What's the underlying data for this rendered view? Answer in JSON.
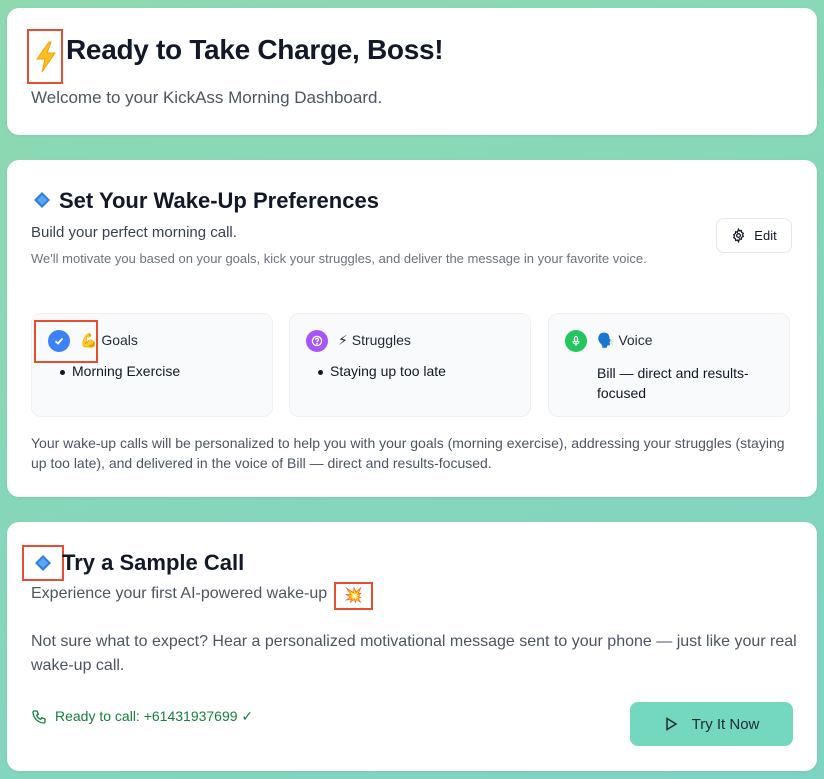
{
  "hero": {
    "title": "Ready to Take Charge, Boss!",
    "subtitle": "Welcome to your KickAss Morning Dashboard.",
    "icon": "lightning-bolt-icon"
  },
  "preferences": {
    "title": "Set Your Wake-Up Preferences",
    "subtitle": "Build your perfect morning call.",
    "description": "We'll motivate you based on your goals, kick your struggles, and deliver the message in your favorite voice.",
    "edit_label": "Edit",
    "goals": {
      "emoji": "💪",
      "label": "Goals",
      "items": [
        "Morning Exercise"
      ],
      "icon_color": "#3b82f6"
    },
    "struggles": {
      "emoji": "⚡",
      "label": "Struggles",
      "items": [
        "Staying up too late"
      ],
      "icon_color": "#a855f7"
    },
    "voice": {
      "emoji": "🗣️",
      "label": "Voice",
      "value": "Bill — direct and results-focused",
      "icon_color": "#22c55e"
    },
    "summary": "Your wake-up calls will be personalized to help you with your goals (morning exercise), addressing your struggles (staying up too late), and delivered in the voice of Bill — direct and results-focused."
  },
  "sample_call": {
    "title": "Try a Sample Call",
    "subtitle": "Experience your first AI-powered wake-up",
    "subtitle_emoji": "💥",
    "description": "Not sure what to expect? Hear a personalized motivational message sent to your phone — just like your real wake-up call.",
    "status": "Ready to call: +61431937699 ✓",
    "button_label": "Try It Now"
  },
  "colors": {
    "accent_teal": "#74d8bf",
    "status_green": "#15803d",
    "highlight_red": "#e4502f"
  }
}
